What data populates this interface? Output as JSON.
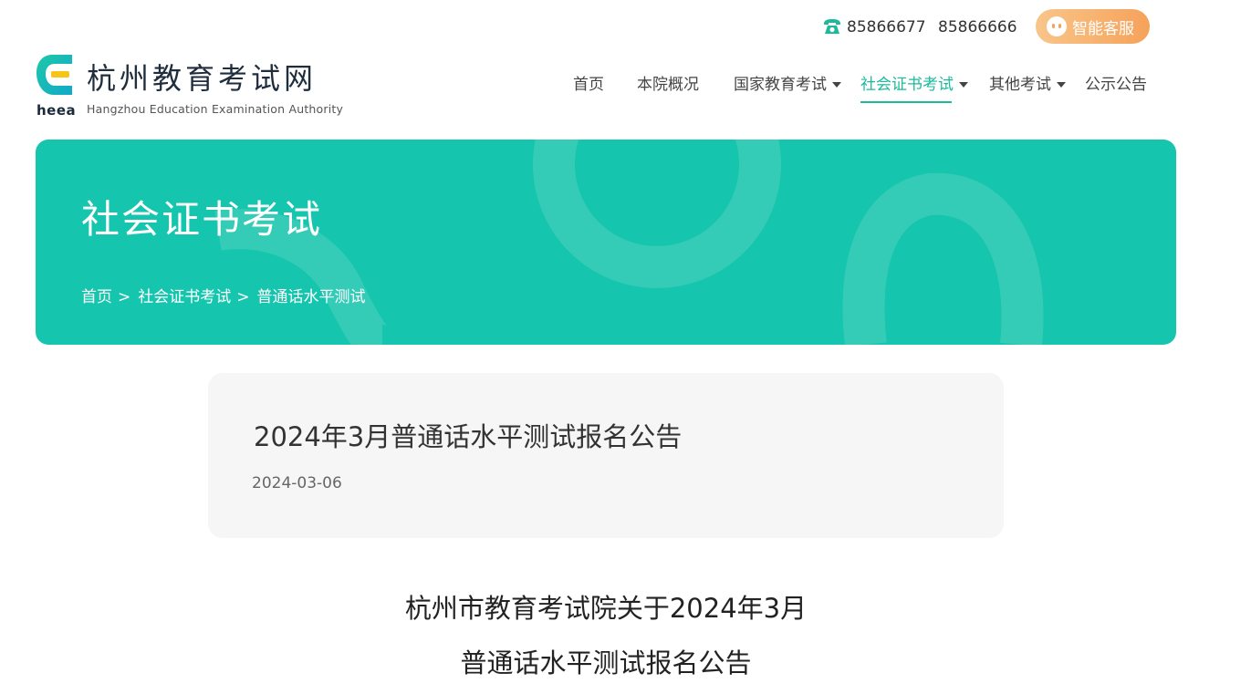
{
  "contact": {
    "phone_1": "85866677",
    "phone_2": "85866666",
    "service_label": "智能客服"
  },
  "logo": {
    "abbr": "heea",
    "name": "杭州教育考试网",
    "english": "Hangzhou Education Examination Authority"
  },
  "nav": {
    "items": [
      {
        "label": "首页"
      },
      {
        "label": "本院概况"
      },
      {
        "label": "国家教育考试"
      },
      {
        "label": "社会证书考试"
      },
      {
        "label": "其他考试"
      },
      {
        "label": "公示公告"
      }
    ],
    "active_index": 3
  },
  "banner": {
    "title": "社会证书考试",
    "breadcrumb": [
      "首页",
      "社会证书考试",
      "普通话水平测试"
    ],
    "separator": ">"
  },
  "article": {
    "title": "2024年3月普通话水平测试报名公告",
    "date": "2024-03-06",
    "heading_line_1": "杭州市教育考试院关于2024年3月",
    "heading_line_2": "普通话水平测试报名公告"
  },
  "colors": {
    "accent": "#16c5ad",
    "nav_active": "#1cb99d",
    "service_gradient_start": "#f9c58a",
    "service_gradient_end": "#f5a25a"
  },
  "icons": {
    "phone": "phone-icon",
    "service": "robot-icon",
    "logo_mark": "heea-logo-mark",
    "nav_dropdown": "caret-down-icon"
  }
}
